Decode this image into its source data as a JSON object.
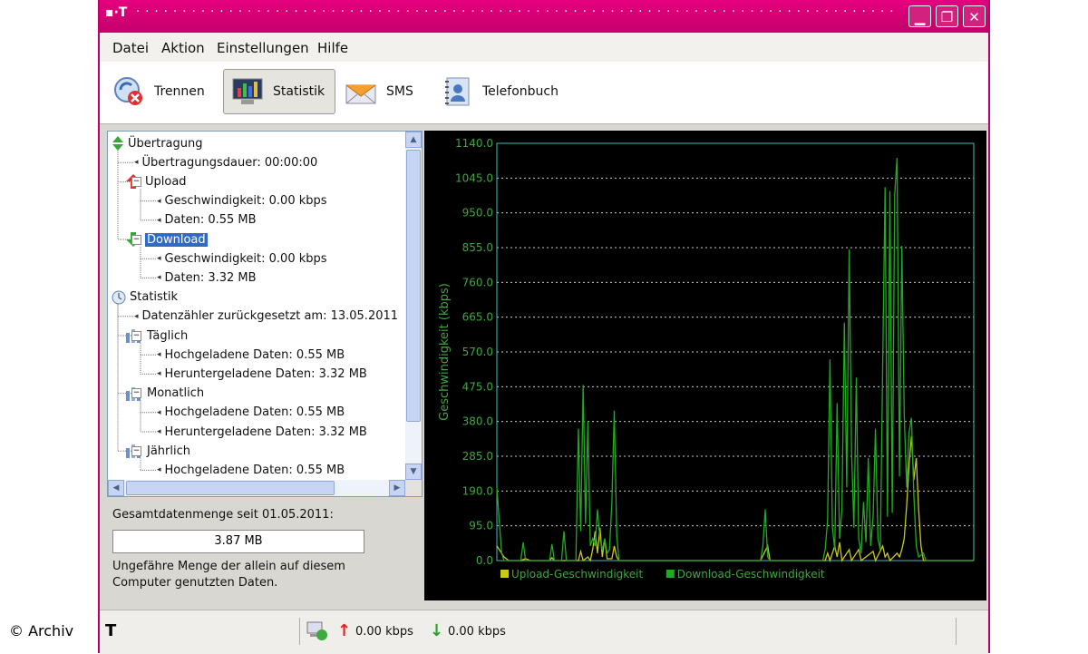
{
  "watermark": "© Archiv",
  "titlebar": {
    "logo": "▪·T",
    "dots": "· · · · · · · · · · · · · · · · · · · · · · · · · · · · · · · · · · · · · · · · · · · · · · · · · · · · · · · · · · · · · · · · · · · · · · · · · · · · · · · · · · · · ·",
    "buttons": [
      "minimize",
      "restore",
      "close"
    ]
  },
  "menu": [
    "Datei",
    "Aktion",
    "Einstellungen",
    "Hilfe"
  ],
  "toolbar": [
    {
      "label": "Trennen",
      "icon": "disconnect-icon"
    },
    {
      "label": "Statistik",
      "icon": "statistics-icon",
      "active": true
    },
    {
      "label": "SMS",
      "icon": "envelope-icon"
    },
    {
      "label": "Telefonbuch",
      "icon": "phonebook-icon"
    }
  ],
  "tree": [
    {
      "text": "Übertragung",
      "level": 0,
      "icon": "transfer-icon"
    },
    {
      "text": "Übertragungsdauer: 00:00:00",
      "level": 1
    },
    {
      "text": "Upload",
      "level": 1,
      "icon": "upload-arrow-icon",
      "expander": "⊟"
    },
    {
      "text": "Geschwindigkeit: 0.00 kbps",
      "level": 2
    },
    {
      "text": "Daten: 0.55 MB",
      "level": 2
    },
    {
      "text": "Download",
      "level": 1,
      "icon": "download-arrow-icon",
      "expander": "⊟",
      "selected": true
    },
    {
      "text": "Geschwindigkeit: 0.00 kbps",
      "level": 2
    },
    {
      "text": "Daten: 3.32 MB",
      "level": 2
    },
    {
      "text": "Statistik",
      "level": 0,
      "icon": "clock-icon"
    },
    {
      "text": "Datenzähler zurückgesetzt am: 13.05.2011",
      "level": 1
    },
    {
      "text": "Täglich",
      "level": 1,
      "icon": "stats-bars-icon",
      "expander": "⊟"
    },
    {
      "text": "Hochgeladene Daten: 0.55 MB",
      "level": 2
    },
    {
      "text": "Heruntergeladene Daten: 3.32 MB",
      "level": 2
    },
    {
      "text": "Monatlich",
      "level": 1,
      "icon": "stats-bars-icon",
      "expander": "⊟"
    },
    {
      "text": "Hochgeladene Daten: 0.55 MB",
      "level": 2
    },
    {
      "text": "Heruntergeladene Daten: 3.32 MB",
      "level": 2
    },
    {
      "text": "Jährlich",
      "level": 1,
      "icon": "stats-bars-icon",
      "expander": "⊟"
    },
    {
      "text": "Hochgeladene Daten: 0.55 MB",
      "level": 2
    }
  ],
  "total": {
    "label": "Gesamtdatenmenge seit 01.05.2011:",
    "value": "3.87 MB",
    "note": "Ungefähre Menge der allein auf diesem Computer genutzten Daten."
  },
  "status": {
    "upload": "0.00 kbps",
    "download": "0.00 kbps"
  },
  "colors": {
    "brand": "#e6007e",
    "download": "#22aa22",
    "upload": "#c8c81e",
    "axis": "#44bbbb",
    "text_axis": "#3fa63f"
  },
  "chart_data": {
    "type": "line",
    "ylabel": "Geschwindigkeit (kbps)",
    "yticks": [
      "0.0",
      "95.0",
      "190.0",
      "285.0",
      "380.0",
      "475.0",
      "570.0",
      "665.0",
      "760.0",
      "855.0",
      "950.0",
      "1045.0",
      "1140.0"
    ],
    "ylim": [
      0,
      1140
    ],
    "grid": true,
    "legend_position": "bottom-left",
    "x_count": 200,
    "series": [
      {
        "name": "Upload-Geschwindigkeit",
        "color": "#c8c81e",
        "points": [
          [
            0,
            40
          ],
          [
            3,
            10
          ],
          [
            5,
            0
          ],
          [
            10,
            0
          ],
          [
            12,
            5
          ],
          [
            14,
            0
          ],
          [
            22,
            0
          ],
          [
            23,
            8
          ],
          [
            24,
            0
          ],
          [
            34,
            0
          ],
          [
            35,
            25
          ],
          [
            36,
            0
          ],
          [
            38,
            10
          ],
          [
            39,
            0
          ],
          [
            40,
            30
          ],
          [
            41,
            80
          ],
          [
            42,
            20
          ],
          [
            43,
            90
          ],
          [
            44,
            10
          ],
          [
            45,
            60
          ],
          [
            46,
            5
          ],
          [
            48,
            5
          ],
          [
            49,
            40
          ],
          [
            50,
            10
          ],
          [
            51,
            0
          ],
          [
            110,
            0
          ],
          [
            113,
            40
          ],
          [
            114,
            0
          ],
          [
            137,
            0
          ],
          [
            138,
            20
          ],
          [
            139,
            0
          ],
          [
            141,
            40
          ],
          [
            142,
            10
          ],
          [
            143,
            50
          ],
          [
            144,
            0
          ],
          [
            147,
            30
          ],
          [
            148,
            0
          ],
          [
            151,
            30
          ],
          [
            152,
            0
          ],
          [
            157,
            25
          ],
          [
            158,
            0
          ],
          [
            161,
            40
          ],
          [
            162,
            10
          ],
          [
            163,
            20
          ],
          [
            164,
            0
          ],
          [
            167,
            20
          ],
          [
            168,
            10
          ],
          [
            169,
            30
          ],
          [
            170,
            60
          ],
          [
            171,
            150
          ],
          [
            172,
            260
          ],
          [
            173,
            340
          ],
          [
            174,
            220
          ],
          [
            175,
            280
          ],
          [
            176,
            140
          ],
          [
            177,
            40
          ],
          [
            178,
            0
          ],
          [
            190,
            0
          ],
          [
            199,
            0
          ]
        ]
      },
      {
        "name": "Download-Geschwindigkeit",
        "color": "#22aa22",
        "points": [
          [
            0,
            200
          ],
          [
            1,
            110
          ],
          [
            2,
            20
          ],
          [
            3,
            0
          ],
          [
            10,
            0
          ],
          [
            11,
            50
          ],
          [
            12,
            0
          ],
          [
            22,
            0
          ],
          [
            23,
            45
          ],
          [
            24,
            0
          ],
          [
            27,
            0
          ],
          [
            28,
            80
          ],
          [
            29,
            0
          ],
          [
            33,
            0
          ],
          [
            34,
            360
          ],
          [
            35,
            80
          ],
          [
            36,
            480
          ],
          [
            37,
            100
          ],
          [
            38,
            380
          ],
          [
            39,
            40
          ],
          [
            40,
            60
          ],
          [
            41,
            40
          ],
          [
            42,
            140
          ],
          [
            43,
            60
          ],
          [
            44,
            30
          ],
          [
            45,
            60
          ],
          [
            46,
            20
          ],
          [
            47,
            30
          ],
          [
            48,
            160
          ],
          [
            49,
            410
          ],
          [
            50,
            70
          ],
          [
            51,
            0
          ],
          [
            110,
            0
          ],
          [
            111,
            40
          ],
          [
            112,
            140
          ],
          [
            113,
            10
          ],
          [
            114,
            0
          ],
          [
            136,
            0
          ],
          [
            137,
            30
          ],
          [
            138,
            110
          ],
          [
            139,
            550
          ],
          [
            140,
            90
          ],
          [
            141,
            30
          ],
          [
            142,
            430
          ],
          [
            143,
            60
          ],
          [
            144,
            140
          ],
          [
            145,
            650
          ],
          [
            146,
            200
          ],
          [
            147,
            850
          ],
          [
            148,
            300
          ],
          [
            149,
            90
          ],
          [
            150,
            500
          ],
          [
            151,
            60
          ],
          [
            152,
            20
          ],
          [
            153,
            160
          ],
          [
            154,
            50
          ],
          [
            155,
            280
          ],
          [
            156,
            40
          ],
          [
            157,
            120
          ],
          [
            158,
            360
          ],
          [
            159,
            60
          ],
          [
            160,
            30
          ],
          [
            161,
            540
          ],
          [
            162,
            1020
          ],
          [
            163,
            120
          ],
          [
            164,
            1010
          ],
          [
            165,
            130
          ],
          [
            166,
            1000
          ],
          [
            167,
            1100
          ],
          [
            168,
            230
          ],
          [
            169,
            860
          ],
          [
            170,
            400
          ],
          [
            171,
            200
          ],
          [
            172,
            350
          ],
          [
            173,
            390
          ],
          [
            174,
            180
          ],
          [
            175,
            40
          ],
          [
            176,
            10
          ],
          [
            178,
            20
          ],
          [
            179,
            0
          ],
          [
            199,
            0
          ]
        ]
      }
    ]
  }
}
